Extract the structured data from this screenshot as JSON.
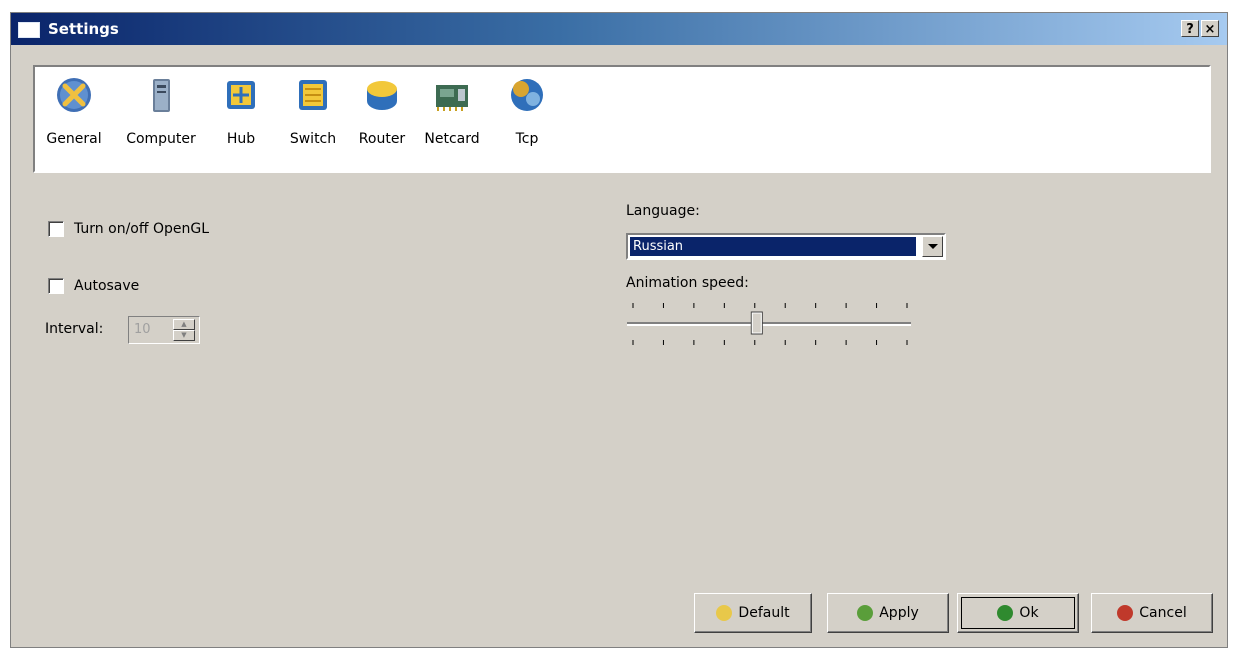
{
  "window": {
    "title": "Settings",
    "help_label": "?",
    "close_label": "×"
  },
  "toolbar": {
    "items": [
      {
        "label": "General",
        "icon": "general-tools-icon"
      },
      {
        "label": "Computer",
        "icon": "computer-tower-icon"
      },
      {
        "label": "Hub",
        "icon": "hub-icon"
      },
      {
        "label": "Switch",
        "icon": "switch-icon"
      },
      {
        "label": "Router",
        "icon": "router-icon"
      },
      {
        "label": "Netcard",
        "icon": "netcard-icon"
      },
      {
        "label": "Tcp",
        "icon": "tcp-icon"
      }
    ]
  },
  "general": {
    "opengl_label": "Turn on/off OpenGL",
    "opengl_checked": false,
    "autosave_label": "Autosave",
    "autosave_checked": false,
    "interval_label": "Interval:",
    "interval_value": "10",
    "language_label": "Language:",
    "language_value": "Russian",
    "animation_label": "Animation speed:",
    "animation_speed_level": 0.45
  },
  "buttons": {
    "default_label": "Default",
    "apply_label": "Apply",
    "ok_label": "Ok",
    "cancel_label": "Cancel"
  },
  "colors": {
    "title_bar": "#0a246a",
    "selection": "#0a246a",
    "face": "#d4d0c8"
  }
}
